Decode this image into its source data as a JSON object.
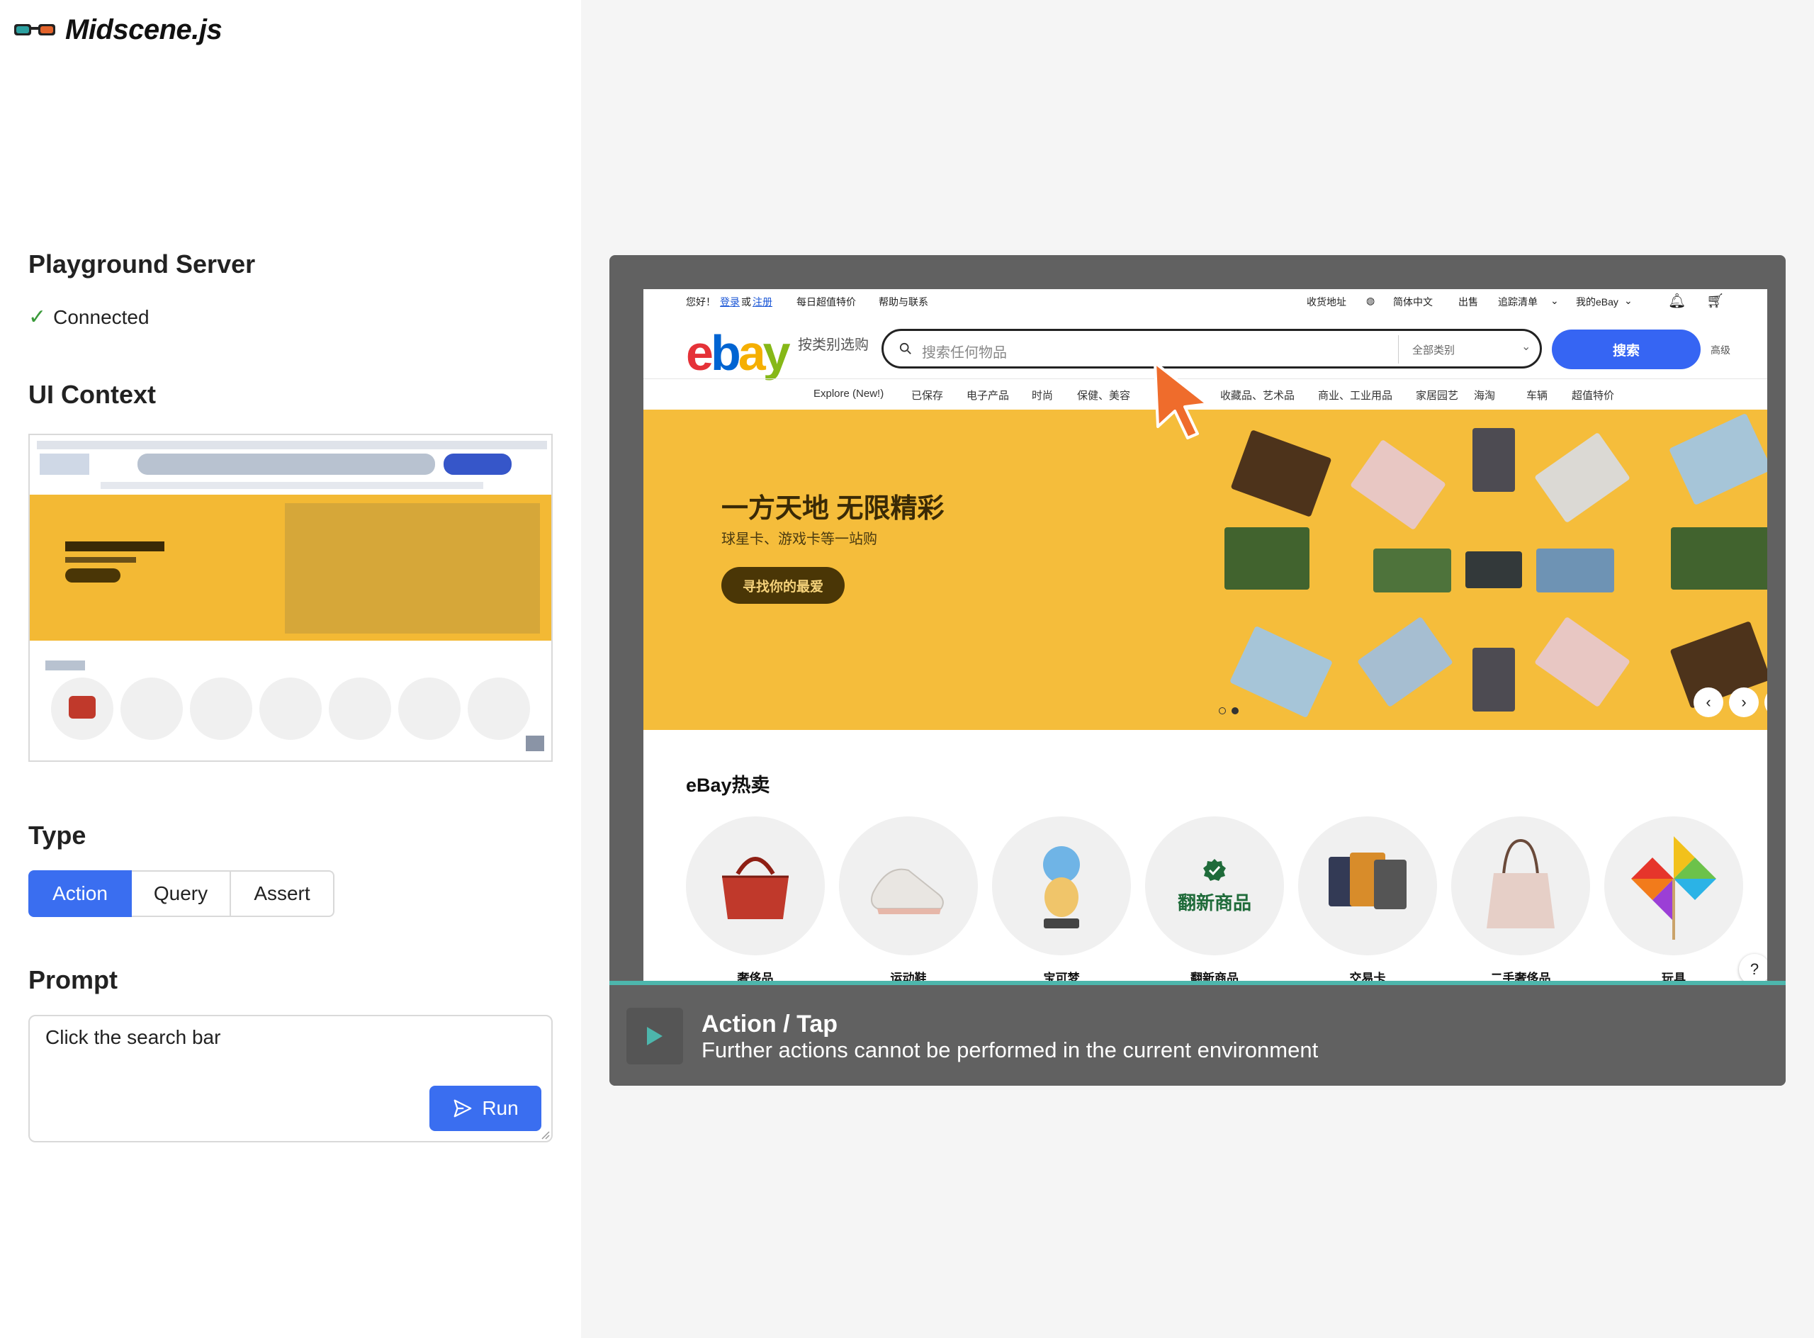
{
  "app": {
    "name": "Midscene.js"
  },
  "left": {
    "server_heading": "Playground Server",
    "server_status": "Connected",
    "context_heading": "UI Context",
    "type_heading": "Type",
    "type_options": [
      "Action",
      "Query",
      "Assert"
    ],
    "type_selected": "Action",
    "prompt_heading": "Prompt",
    "prompt_value": "Click the search bar",
    "run_label": "Run"
  },
  "viewer": {
    "action_title": "Action / Tap",
    "action_desc": "Further actions cannot be performed in the current environment"
  },
  "ebay": {
    "greeting": "您好！",
    "login": "登录",
    "or": "或",
    "register": "注册",
    "daily_deals": "每日超值特价",
    "help": "帮助与联系",
    "ship_to": "收货地址",
    "language": "简体中文",
    "sell": "出售",
    "watchlist": "追踪清单",
    "my_ebay": "我的eBay",
    "logo": [
      "e",
      "b",
      "a",
      "y"
    ],
    "logo_colors": [
      "#e53238",
      "#0064d2",
      "#f5af02",
      "#86b817"
    ],
    "shop_by_category": "按类别选购",
    "search_placeholder": "搜索任何物品",
    "all_categories": "全部类别",
    "search_button": "搜索",
    "advanced": "高级",
    "nav": [
      "Explore (New!)",
      "已保存",
      "电子产品",
      "时尚",
      "保健、美容",
      "收藏品、艺术品",
      "商业、工业用品",
      "家居园艺",
      "海淘",
      "车辆",
      "超值特价"
    ],
    "hero_title": "一方天地 无限精彩",
    "hero_sub": "球星卡、游戏卡等一站购",
    "hero_button": "寻找你的最爱",
    "hot_heading": "eBay热卖",
    "hot_items": [
      "奢侈品",
      "运动鞋",
      "宝可梦",
      "翻新商品",
      "交易卡",
      "二手奢侈品",
      "玩具"
    ],
    "refurb_badge": "翻新商品",
    "help_glyph": "?"
  },
  "colors": {
    "accent": "#3a6ef0",
    "ebay_blue": "#3665f3",
    "hero_bg": "#f5bd3b",
    "progress": "#4db6ac"
  }
}
